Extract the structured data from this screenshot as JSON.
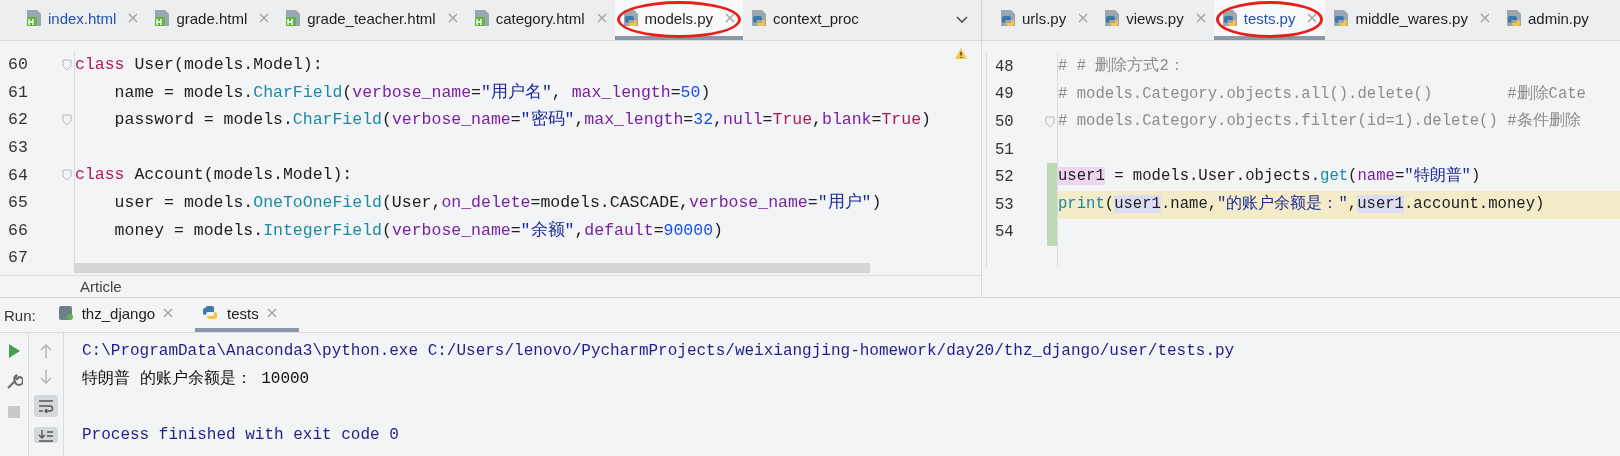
{
  "left_pane": {
    "tabs": [
      {
        "label": "index.html",
        "kind": "html",
        "selected": false,
        "modified": true,
        "circled": false
      },
      {
        "label": "grade.html",
        "kind": "html",
        "selected": false,
        "modified": false,
        "circled": false
      },
      {
        "label": "grade_teacher.html",
        "kind": "html",
        "selected": false,
        "modified": false,
        "circled": false
      },
      {
        "label": "category.html",
        "kind": "html",
        "selected": false,
        "modified": false,
        "circled": false
      },
      {
        "label": "models.py",
        "kind": "python",
        "selected": true,
        "modified": false,
        "circled": true
      },
      {
        "label": "context_proc",
        "kind": "python",
        "selected": false,
        "modified": false,
        "circled": false
      }
    ],
    "lines": [
      {
        "number": "60",
        "fold": true,
        "current": false,
        "tokens": [
          {
            "text": "class",
            "kind": "kw"
          },
          {
            "text": " User(models.Model):",
            "kind": "pl"
          }
        ]
      },
      {
        "number": "61",
        "fold": false,
        "current": false,
        "tokens": [
          {
            "text": "    name = models.",
            "kind": "pl"
          },
          {
            "text": "CharField",
            "kind": "fn"
          },
          {
            "text": "(",
            "kind": "pl"
          },
          {
            "text": "verbose_name",
            "kind": "param"
          },
          {
            "text": "=",
            "kind": "pl"
          },
          {
            "text": "\"用户名\"",
            "kind": "str"
          },
          {
            "text": ", ",
            "kind": "pl"
          },
          {
            "text": "max_length",
            "kind": "param"
          },
          {
            "text": "=",
            "kind": "pl"
          },
          {
            "text": "50",
            "kind": "num"
          },
          {
            "text": ")",
            "kind": "pl"
          }
        ]
      },
      {
        "number": "62",
        "fold": true,
        "current": false,
        "tokens": [
          {
            "text": "    password = models.",
            "kind": "pl"
          },
          {
            "text": "CharField",
            "kind": "fn"
          },
          {
            "text": "(",
            "kind": "pl"
          },
          {
            "text": "verbose_name",
            "kind": "param"
          },
          {
            "text": "=",
            "kind": "pl"
          },
          {
            "text": "\"密码\"",
            "kind": "str"
          },
          {
            "text": ",",
            "kind": "pl"
          },
          {
            "text": "max_length",
            "kind": "param"
          },
          {
            "text": "=",
            "kind": "pl"
          },
          {
            "text": "32",
            "kind": "num"
          },
          {
            "text": ",",
            "kind": "pl"
          },
          {
            "text": "null",
            "kind": "param"
          },
          {
            "text": "=",
            "kind": "pl"
          },
          {
            "text": "True",
            "kind": "kw"
          },
          {
            "text": ",",
            "kind": "pl"
          },
          {
            "text": "blank",
            "kind": "param"
          },
          {
            "text": "=",
            "kind": "pl"
          },
          {
            "text": "True",
            "kind": "kw"
          },
          {
            "text": ")",
            "kind": "pl"
          }
        ]
      },
      {
        "number": "63",
        "fold": false,
        "current": false
      },
      {
        "number": "64",
        "fold": true,
        "current": false,
        "tokens": [
          {
            "text": "class",
            "kind": "kw"
          },
          {
            "text": " Account(models.Model):",
            "kind": "pl"
          }
        ]
      },
      {
        "number": "65",
        "fold": false,
        "current": false,
        "tokens": [
          {
            "text": "    user = models.",
            "kind": "pl"
          },
          {
            "text": "OneToOneField",
            "kind": "fn"
          },
          {
            "text": "(User,",
            "kind": "pl"
          },
          {
            "text": "on_delete",
            "kind": "param"
          },
          {
            "text": "=models.CASCADE,",
            "kind": "pl"
          },
          {
            "text": "verbose_name",
            "kind": "param"
          },
          {
            "text": "=",
            "kind": "pl"
          },
          {
            "text": "\"用户\"",
            "kind": "str"
          },
          {
            "text": ")",
            "kind": "pl"
          }
        ]
      },
      {
        "number": "66",
        "fold": false,
        "current": false,
        "tokens": [
          {
            "text": "    money = models.",
            "kind": "pl"
          },
          {
            "text": "IntegerField",
            "kind": "fn"
          },
          {
            "text": "(",
            "kind": "pl"
          },
          {
            "text": "verbose_name",
            "kind": "param"
          },
          {
            "text": "=",
            "kind": "pl"
          },
          {
            "text": "\"余额\"",
            "kind": "str"
          },
          {
            "text": ",",
            "kind": "pl"
          },
          {
            "text": "default",
            "kind": "param"
          },
          {
            "text": "=",
            "kind": "pl"
          },
          {
            "text": "90000",
            "kind": "num"
          },
          {
            "text": ")",
            "kind": "pl"
          }
        ]
      },
      {
        "number": "67",
        "fold": false,
        "current": false
      }
    ],
    "breadcrumb": "Article"
  },
  "right_pane": {
    "tabs": [
      {
        "label": "urls.py",
        "kind": "python",
        "selected": false,
        "modified": false,
        "circled": false
      },
      {
        "label": "views.py",
        "kind": "python",
        "selected": false,
        "modified": false,
        "circled": false
      },
      {
        "label": "tests.py",
        "kind": "python",
        "selected": true,
        "modified": true,
        "circled": true
      },
      {
        "label": "middle_wares.py",
        "kind": "python",
        "selected": false,
        "modified": false,
        "circled": false
      },
      {
        "label": "admin.py",
        "kind": "python",
        "selected": false,
        "modified": false,
        "circled": false
      }
    ],
    "lines": [
      {
        "number": "48",
        "fold": false,
        "current": false,
        "changed": false,
        "tokens": [
          {
            "text": "# # 删除方式2：",
            "kind": "cm"
          }
        ]
      },
      {
        "number": "49",
        "fold": false,
        "current": false,
        "changed": false,
        "tokens": [
          {
            "text": "# models.Category.objects.all().delete()        #删除Cate",
            "kind": "cm"
          }
        ]
      },
      {
        "number": "50",
        "fold": true,
        "current": false,
        "changed": false,
        "tokens": [
          {
            "text": "# models.Category.objects.filter(id=1).delete() #条件删除",
            "kind": "cm"
          }
        ]
      },
      {
        "number": "51",
        "fold": false,
        "current": false,
        "changed": false
      },
      {
        "number": "52",
        "fold": false,
        "current": false,
        "changed": true,
        "tokens": [
          {
            "text": "user1",
            "kind": "var1"
          },
          {
            "text": " = models.User.objects.",
            "kind": "pl"
          },
          {
            "text": "get",
            "kind": "fn"
          },
          {
            "text": "(",
            "kind": "pl"
          },
          {
            "text": "name",
            "kind": "param"
          },
          {
            "text": "=",
            "kind": "pl"
          },
          {
            "text": "\"特朗普\"",
            "kind": "str"
          },
          {
            "text": ")",
            "kind": "pl"
          }
        ]
      },
      {
        "number": "53",
        "fold": false,
        "current": true,
        "changed": true,
        "tokens": [
          {
            "text": "print",
            "kind": "fn"
          },
          {
            "text": "(",
            "kind": "pl"
          },
          {
            "text": "user1",
            "kind": "var2"
          },
          {
            "text": ".name,",
            "kind": "pl"
          },
          {
            "text": "\"的账户余额是：\"",
            "kind": "str"
          },
          {
            "text": ",",
            "kind": "pl"
          },
          {
            "text": "user1",
            "kind": "var2"
          },
          {
            "text": ".account.money)",
            "kind": "pl"
          }
        ]
      },
      {
        "number": "54",
        "fold": false,
        "current": false,
        "changed": true
      }
    ]
  },
  "run": {
    "label": "Run:",
    "tabs": [
      {
        "label": "thz_django",
        "kind": "django",
        "selected": false
      },
      {
        "label": "tests",
        "kind": "python",
        "selected": true
      }
    ],
    "console": [
      {
        "kind": "command",
        "text": "C:\\ProgramData\\Anaconda3\\python.exe C:/Users/lenovo/PycharmProjects/weixiangjing-homework/day20/thz_django/user/tests.py"
      },
      {
        "kind": "output",
        "text": "特朗普 的账户余额是： 10000"
      },
      {
        "kind": "exit",
        "text": "Process finished with exit code 0"
      }
    ]
  }
}
